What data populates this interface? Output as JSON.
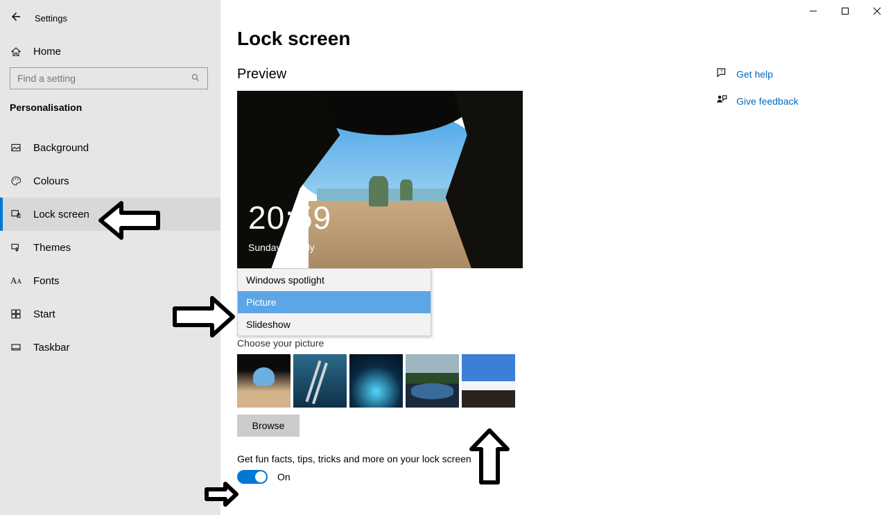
{
  "window": {
    "title": "Settings"
  },
  "sidebar": {
    "home": "Home",
    "search_placeholder": "Find a setting",
    "section": "Personalisation",
    "items": [
      {
        "label": "Background"
      },
      {
        "label": "Colours"
      },
      {
        "label": "Lock screen"
      },
      {
        "label": "Themes"
      },
      {
        "label": "Fonts"
      },
      {
        "label": "Start"
      },
      {
        "label": "Taskbar"
      }
    ]
  },
  "main": {
    "title": "Lock screen",
    "preview_heading": "Preview",
    "preview_time": "20:59",
    "preview_date": "Sunday 26 July",
    "background_dropdown": {
      "options": [
        "Windows spotlight",
        "Picture",
        "Slideshow"
      ],
      "selected": "Picture"
    },
    "choose_picture_label": "Choose your picture",
    "browse_label": "Browse",
    "fun_facts_label": "Get fun facts, tips, tricks and more on your lock screen",
    "toggle_state": "On"
  },
  "help": {
    "get_help": "Get help",
    "give_feedback": "Give feedback"
  }
}
